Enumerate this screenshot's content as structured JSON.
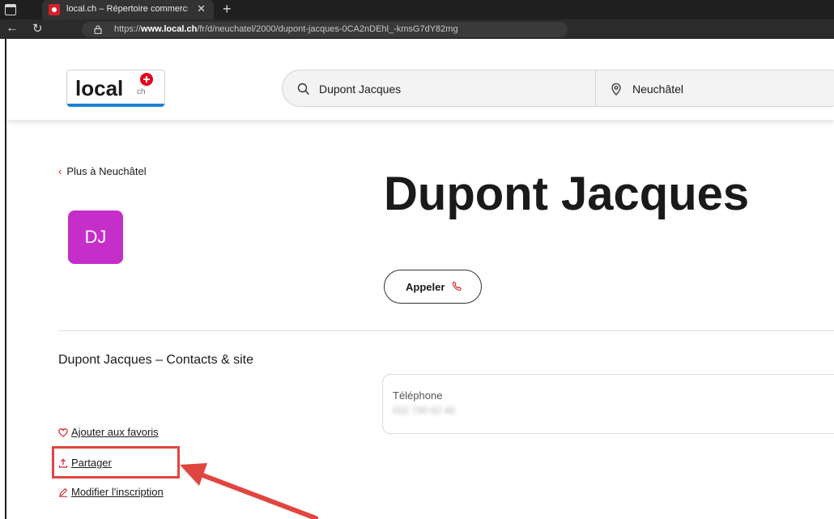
{
  "browser": {
    "tab_title": "local.ch – Répertoire commercial",
    "tab_close": "✕",
    "new_tab": "+",
    "url_prefix": "https://",
    "url_domain": "www.local.ch",
    "url_path": "/fr/d/neuchatel/2000/dupont-jacques-0CA2nDEhl_-kmsG7dY82mg"
  },
  "header": {
    "logo_text": "local",
    "logo_sub": "ch",
    "search_what": "Dupont Jacques",
    "search_where": "Neuchâtel"
  },
  "profile": {
    "back_link": "Plus à Neuchâtel",
    "avatar_initials": "DJ",
    "name": "Dupont Jacques",
    "call_label": "Appeler",
    "section_title": "Dupont Jacques – Contacts & site",
    "phone_label": "Téléphone",
    "phone_value": "032 730 62 46"
  },
  "actions": {
    "favorite": "Ajouter aux favoris",
    "share": "Partager",
    "edit": "Modifier l'inscription"
  },
  "colors": {
    "accent": "#d4202a",
    "avatar": "#c52ec8",
    "annotation": "#e0463f"
  }
}
